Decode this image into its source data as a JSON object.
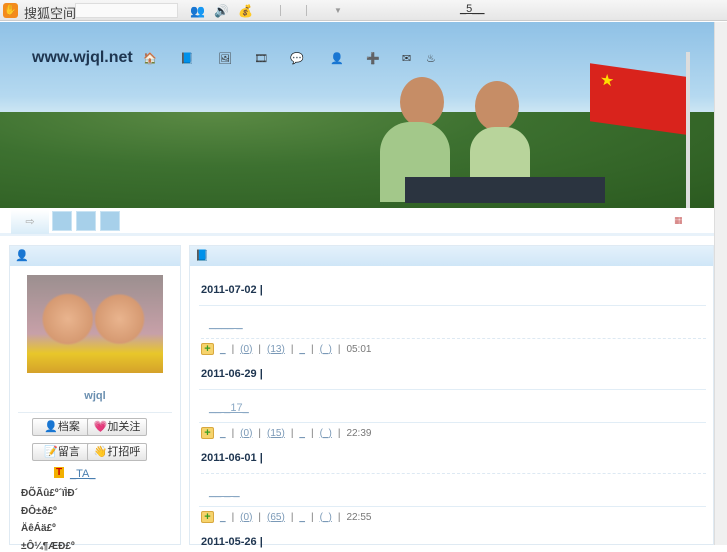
{
  "topbar": {
    "brand": "搜狐空间",
    "search_placeholder": "",
    "page_num": "_5__"
  },
  "banner": {
    "site_title": "www.wjql.net",
    "nav_separators": "_"
  },
  "left_panel": {
    "username": "wjql",
    "buttons": [
      "档案",
      "加关注",
      "留言",
      "打招呼"
    ],
    "ta_link": "_TA_",
    "info": [
      "ÐÕÃû£º´ïÌÐ´",
      "ÐÔ±ð£º",
      "ÄêÁä£º",
      "±Ô¼¶ÆÐ£º"
    ]
  },
  "posts": [
    {
      "date": "2011-07-02 |",
      "title": "____ _",
      "actions": [
        "_",
        "(0)",
        "(13)",
        "_",
        "(_)"
      ],
      "time": "05:01"
    },
    {
      "date": "2011-06-29 |",
      "title": "__ _17_",
      "actions": [
        "_",
        "(0)",
        "(15)",
        "_",
        "(_)"
      ],
      "time": "22:39"
    },
    {
      "date": "2011-06-01 |",
      "title": "__ _ _",
      "actions": [
        "_",
        "(0)",
        "(65)",
        "_",
        "(_)"
      ],
      "time": "22:55"
    },
    {
      "date": "2011-05-26 |"
    }
  ]
}
